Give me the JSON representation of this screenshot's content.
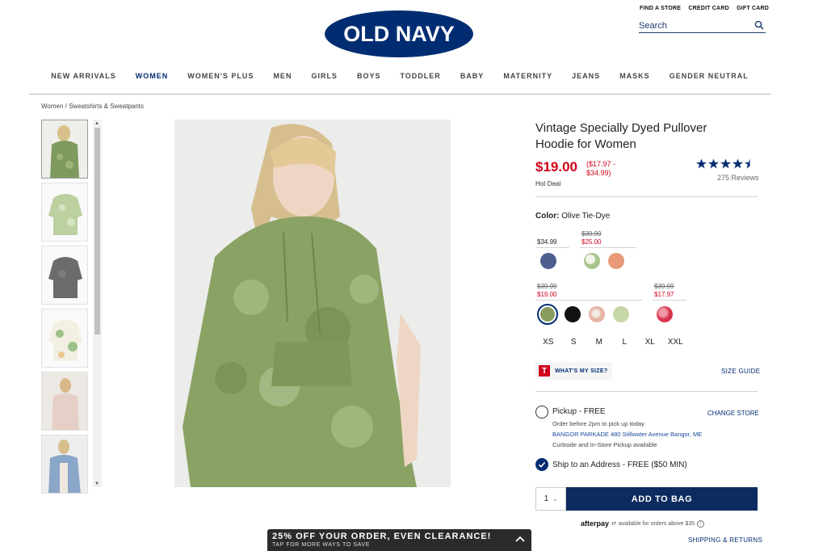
{
  "header": {
    "logo_text": "OLD NAVY",
    "util_links": [
      "FIND A STORE",
      "CREDIT CARD",
      "GIFT CARD"
    ],
    "search_placeholder": "Search"
  },
  "nav": {
    "items": [
      "NEW ARRIVALS",
      "WOMEN",
      "WOMEN'S PLUS",
      "MEN",
      "GIRLS",
      "BOYS",
      "TODDLER",
      "BABY",
      "MATERNITY",
      "JEANS",
      "MASKS",
      "GENDER NEUTRAL"
    ],
    "active_index": 1
  },
  "breadcrumb": {
    "first": "Women",
    "sep": " / ",
    "second": "Sweatshirts & Sweatpants"
  },
  "product": {
    "title": "Vintage Specially Dyed Pullover Hoodie for Women",
    "price": "$19.00",
    "price_range_line1": "($17.97 -",
    "price_range_line2": "$34.99)",
    "hot_deal": "Hot Deal",
    "rating": 4.5,
    "reviews": "275 Reviews",
    "color_label": "Color:",
    "color_value": "Olive Tie-Dye",
    "price_groups": [
      {
        "regular": "$34.99"
      },
      {
        "original": "$39.99",
        "sale": "$25.00"
      },
      {
        "original": "$39.99",
        "sale": "$19.00"
      },
      {
        "original": "$39.99",
        "sale": "$17.97"
      }
    ],
    "swatch_colors": {
      "navy": "#4c5f8e",
      "green_white": "#a8c48e",
      "peach": "#e89a78",
      "olive": "#8a9c5e",
      "black": "#111111",
      "pink_tie": "#e7b3a4",
      "sage": "#c6d6a4",
      "red_tie": "#d9334e"
    },
    "sizes": [
      "XS",
      "S",
      "M",
      "L",
      "XL",
      "XXL"
    ],
    "whats_my_size": "WHAT'S MY SIZE?",
    "size_guide": "SIZE GUIDE",
    "pickup_label": "Pickup - FREE",
    "change_store": "CHANGE STORE",
    "pickup_note": "Order before 2pm to pick up today",
    "store_address": "BANGOR PARKADE 480 Stillwater Avenue  Bangor, ME",
    "curbside": "Curbside and In-Store Pickup available",
    "ship_label": "Ship to an Address - FREE ($50 MIN)",
    "quantity": "1",
    "add_to_bag": "ADD TO BAG",
    "afterpay_logo": "afterpay",
    "afterpay_text": "available for orders above $35",
    "shipping_returns": "SHIPPING & RETURNS"
  },
  "promo": {
    "headline": "25% OFF YOUR ORDER, EVEN CLEARANCE!",
    "sub": "TAP FOR MORE WAYS TO SAVE"
  },
  "colors": {
    "brand_navy": "#002d72",
    "sale_red": "#d0021b",
    "button_navy": "#0d2b5e"
  }
}
